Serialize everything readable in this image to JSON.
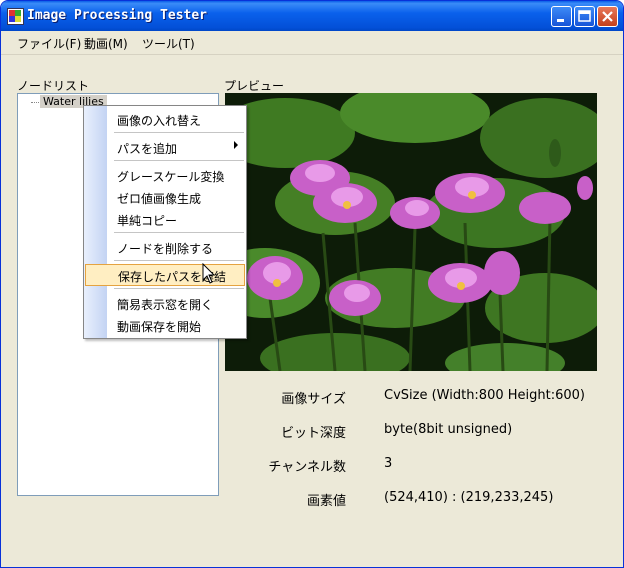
{
  "window": {
    "title": "Image Processing Tester"
  },
  "menu": [
    {
      "label": "ファイル(F)"
    },
    {
      "label": "動画(M)"
    },
    {
      "label": "ツール(T)"
    }
  ],
  "node_list": {
    "label": "ノードリスト",
    "nodes": [
      {
        "label": "Water lilies"
      }
    ]
  },
  "preview": {
    "label": "プレビュー"
  },
  "info": {
    "size": {
      "label": "画像サイズ",
      "value": "CvSize (Width:800 Height:600)"
    },
    "depth": {
      "label": "ビット深度",
      "value": "byte(8bit unsigned)"
    },
    "channel": {
      "label": "チャンネル数",
      "value": "3"
    },
    "pixel": {
      "label": "画素値",
      "value": "(524,410) : (219,233,245)"
    }
  },
  "context_menu": {
    "items": [
      {
        "label": "画像の入れ替え"
      },
      {
        "label": "パスを追加"
      },
      {
        "label": "グレースケール変換"
      },
      {
        "label": "ゼロ値画像生成"
      },
      {
        "label": "単純コピー"
      },
      {
        "label": "ノードを削除する"
      },
      {
        "label": "保存したパスを連結"
      },
      {
        "label": "簡易表示窓を開く"
      },
      {
        "label": "動画保存を開始"
      }
    ]
  },
  "colors": {
    "title_bar": "#0a5ee8",
    "menu_highlight": "#ffeec2",
    "tree_border": "#7f9db9"
  }
}
